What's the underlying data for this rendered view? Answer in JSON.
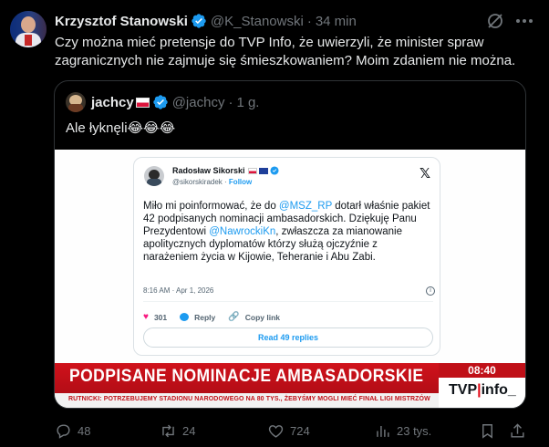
{
  "tweet": {
    "author_name": "Krzysztof Stanowski",
    "handle": "@K_Stanowski",
    "separator": "·",
    "time": "34 min",
    "text": "Czy można mieć pretensje do TVP Info, że uwierzyli, że minister spraw zagranicznych nie zajmuje się śmieszkowaniem? Moim zdaniem nie można."
  },
  "quote": {
    "author_name": "jachcy",
    "handle": "@jachcy",
    "separator": "·",
    "time": "1 g.",
    "text": "Ale łyknęli😂😂😂"
  },
  "embedded": {
    "author_name": "Radosław Sikorski",
    "handle": "@sikorskiradek",
    "follow": "Follow",
    "x_logo": "𝕏",
    "body_part1": "Miło mi poinformować, że do ",
    "mention1": "@MSZ_RP",
    "body_part2": " dotarł właśnie pakiet 42 podpisanych nominacji ambasadorskich. Dziękuję Panu Prezydentowi ",
    "mention2": "@NawrockiKn",
    "body_part3": ", zwłaszcza za mianowanie apolitycznych dyplomatów którzy służą ojczyźnie z narażeniem życia w Kijowie, Teheranie i Abu Zabi.",
    "timestamp": "8:16 AM · Apr 1, 2026",
    "likes": "301",
    "reply_label": "Reply",
    "copy_link_label": "Copy link",
    "read_replies": "Read 49 replies"
  },
  "tv": {
    "headline": "PODPISANE NOMINACJE AMBASADORSKIE",
    "clock": "08:40",
    "logo_left": "TVP",
    "logo_sep": "|",
    "logo_right": "info_",
    "ticker": "RUTNICKI: POTRZEBUJEMY STADIONU NARODOWEGO NA 80 TYS., ŻEBYŚMY MOGLI MIEĆ FINAŁ LIGI MISTRZÓW"
  },
  "actions": {
    "replies": "48",
    "reposts": "24",
    "likes": "724",
    "views": "23 tys."
  },
  "colors": {
    "accent": "#1d9bf0",
    "muted": "#71767b",
    "tv_red": "#c01018"
  }
}
